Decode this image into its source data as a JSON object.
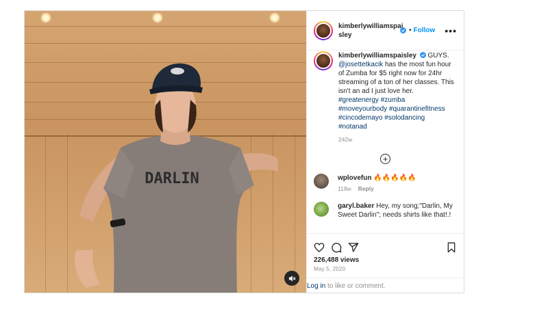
{
  "post": {
    "username": "kimberlywilliamspaisley",
    "follow_label": "Follow",
    "header_separator": "•",
    "more_label": "•••"
  },
  "caption": {
    "username": "kimberlywilliamspaisley",
    "text_1": " GUYS. ",
    "mention": "@josettetkacik",
    "text_2": " has the most fun hour of Zumba for $5 right now for 24hr streaming of a ton of her classes. This isn't an ad I just love her. ",
    "hashtags": "#greatenergy #zumba #moveyourbody #quarantinefitness #cincodemayo #solodancing #notanad",
    "time": "242w"
  },
  "load_more_label": "+",
  "comments": [
    {
      "username": "wplovefun",
      "text": " 🔥🔥🔥🔥🔥",
      "time": "118w",
      "reply_label": "Reply",
      "avatar_color": "#6b5a4e"
    },
    {
      "username": "garyl.baker",
      "text": " Hey, my song;\"Darlin, My Sweet Darlin\"; needs shirts like that!.!",
      "avatar_color": "#7aa646"
    }
  ],
  "shirt_text": "DARLIN",
  "views": "226,488 views",
  "date": "May 5, 2020",
  "login": {
    "link": "Log in",
    "rest": " to like or comment."
  },
  "colors": {
    "accent": "#0095f6",
    "link": "#00376b",
    "muted": "#8e8e8e",
    "verified": "#3897f0"
  },
  "icons": [
    "mute-icon",
    "more-icon",
    "verified-icon",
    "add-circle-icon",
    "heart-icon",
    "comment-icon",
    "share-icon",
    "bookmark-icon"
  ]
}
